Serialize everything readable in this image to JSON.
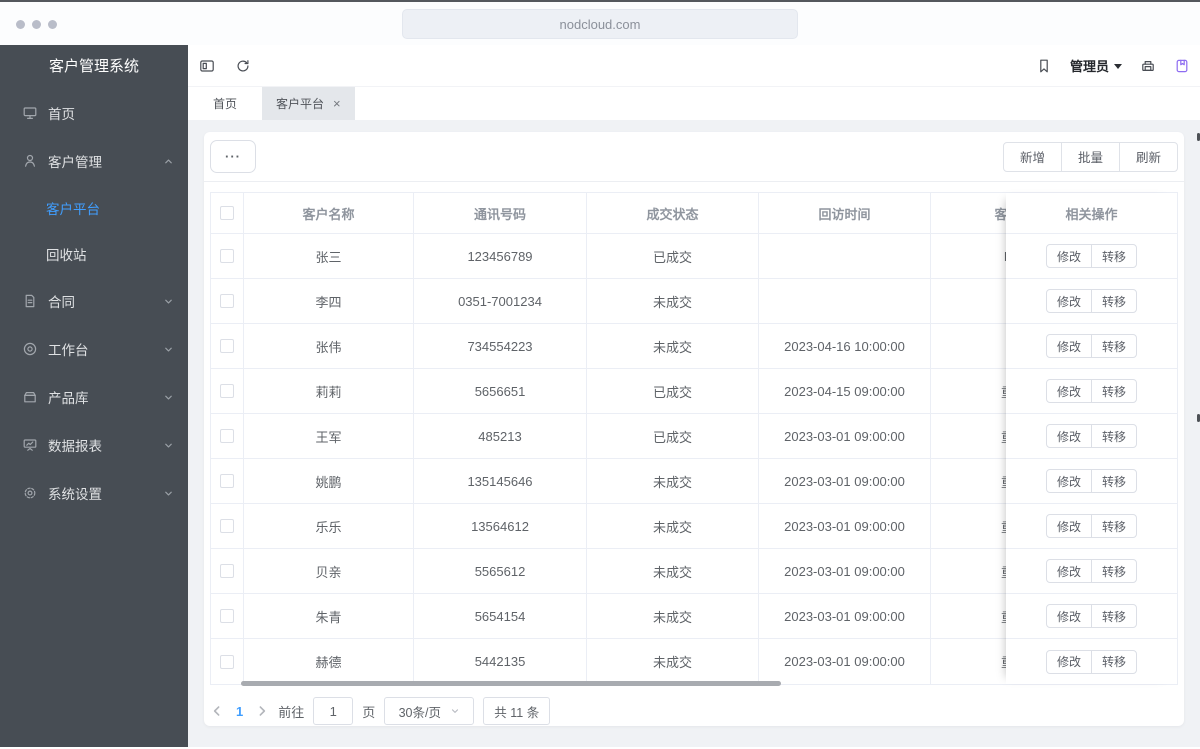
{
  "browser": {
    "url": "nodcloud.com"
  },
  "sidebar": {
    "title": "客户管理系统",
    "items": [
      {
        "label": "首页",
        "icon": "monitor-icon",
        "chevron": null
      },
      {
        "label": "客户管理",
        "icon": "user-icon",
        "chevron": "up",
        "children": [
          {
            "label": "客户平台",
            "active": true
          },
          {
            "label": "回收站",
            "active": false
          }
        ]
      },
      {
        "label": "合同",
        "icon": "document-icon",
        "chevron": "down"
      },
      {
        "label": "工作台",
        "icon": "workbench-icon",
        "chevron": "down"
      },
      {
        "label": "产品库",
        "icon": "product-icon",
        "chevron": "down"
      },
      {
        "label": "数据报表",
        "icon": "report-icon",
        "chevron": "down"
      },
      {
        "label": "系统设置",
        "icon": "settings-icon",
        "chevron": "down"
      }
    ]
  },
  "header": {
    "user": "管理员"
  },
  "tabs": [
    {
      "label": "首页",
      "active": false,
      "closable": false
    },
    {
      "label": "客户平台",
      "active": true,
      "closable": true
    }
  ],
  "actions": {
    "more": "···",
    "add": "新增",
    "batch": "批量",
    "refresh": "刷新"
  },
  "table": {
    "columns": [
      "客户名称",
      "通讯号码",
      "成交状态",
      "回访时间",
      "客户"
    ],
    "fixed_column": "相关操作",
    "op_labels": [
      "修改",
      "转移"
    ],
    "rows": [
      {
        "name": "张三",
        "phone": "123456789",
        "status": "已成交",
        "visit": "",
        "level": "L"
      },
      {
        "name": "李四",
        "phone": "0351-7001234",
        "status": "未成交",
        "visit": "",
        "level": ""
      },
      {
        "name": "张伟",
        "phone": "734554223",
        "status": "未成交",
        "visit": "2023-04-16 10:00:00",
        "level": ""
      },
      {
        "name": "莉莉",
        "phone": "5656651",
        "status": "已成交",
        "visit": "2023-04-15 09:00:00",
        "level": "重"
      },
      {
        "name": "王军",
        "phone": "485213",
        "status": "已成交",
        "visit": "2023-03-01 09:00:00",
        "level": "重"
      },
      {
        "name": "姚鹏",
        "phone": "135145646",
        "status": "未成交",
        "visit": "2023-03-01 09:00:00",
        "level": "重"
      },
      {
        "name": "乐乐",
        "phone": "13564612",
        "status": "未成交",
        "visit": "2023-03-01 09:00:00",
        "level": "重"
      },
      {
        "name": "贝亲",
        "phone": "5565612",
        "status": "未成交",
        "visit": "2023-03-01 09:00:00",
        "level": "重"
      },
      {
        "name": "朱青",
        "phone": "5654154",
        "status": "未成交",
        "visit": "2023-03-01 09:00:00",
        "level": "重"
      },
      {
        "name": "赫德",
        "phone": "5442135",
        "status": "未成交",
        "visit": "2023-03-01 09:00:00",
        "level": "重"
      }
    ]
  },
  "pagination": {
    "current": "1",
    "goto_label": "前往",
    "goto_value": "1",
    "page_label": "页",
    "page_size": "30条/页",
    "total": "共 11 条"
  },
  "colors": {
    "accent": "#409eff",
    "sidebar": "#474d54",
    "purple_icon": "#8e6cf1"
  }
}
